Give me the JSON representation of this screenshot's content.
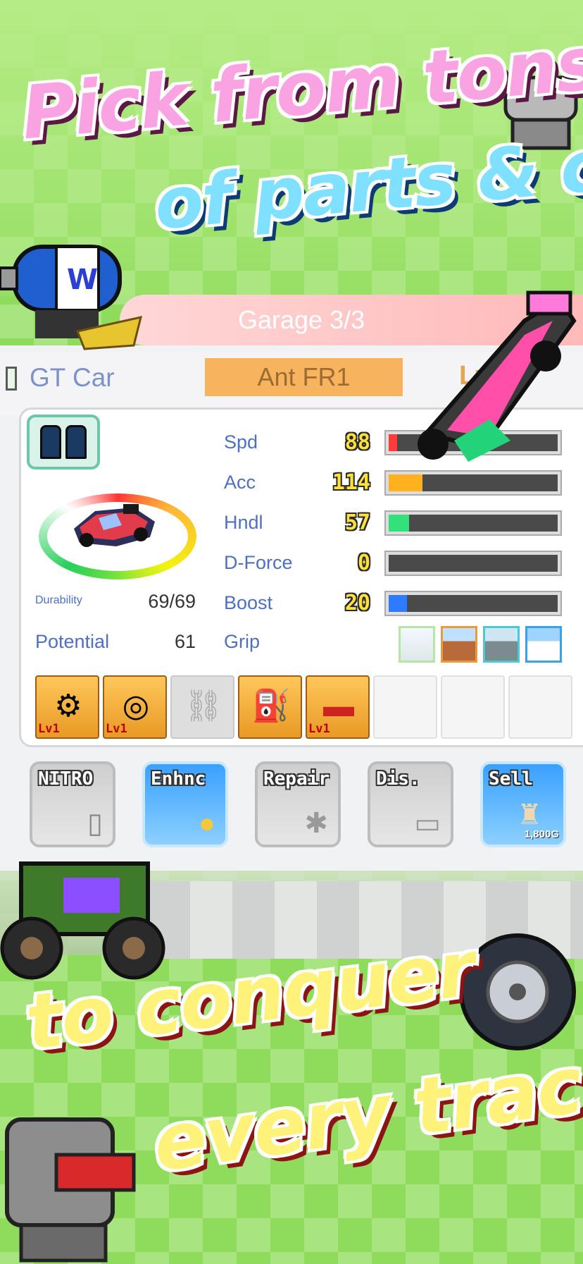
{
  "headline": {
    "line1": "Pick from tons",
    "line2": "of parts & cars",
    "line3": "to conquer",
    "line4": "every track!"
  },
  "garage": {
    "title": "Garage 3/3",
    "car_class": "GT Car",
    "car_name": "Ant FR1",
    "level_mark": "Lv"
  },
  "car": {
    "durability_label": "Durability",
    "durability_value": "69/69",
    "potential_label": "Potential",
    "potential_value": "61"
  },
  "stats": [
    {
      "label": "Spd",
      "value": "88",
      "level": 0.05,
      "color": "#ff3c3c"
    },
    {
      "label": "Acc",
      "value": "114",
      "level": 0.2,
      "color": "#ffb21e"
    },
    {
      "label": "Hndl",
      "value": "57",
      "level": 0.12,
      "color": "#34e07a"
    },
    {
      "label": "D-Force",
      "value": "0",
      "level": 0,
      "color": "#cccccc"
    },
    {
      "label": "Boost",
      "value": "20",
      "level": 0.11,
      "color": "#2f7bff"
    }
  ],
  "grip": {
    "label": "Grip",
    "icons": [
      "road-icon",
      "dirt-icon",
      "gravel-icon",
      "snow-icon"
    ]
  },
  "parts": [
    {
      "icon": "engine-icon",
      "level": "Lv1"
    },
    {
      "icon": "tire-icon",
      "level": "Lv1"
    },
    {
      "icon": "chain-icon",
      "level": ""
    },
    {
      "icon": "oil-can-icon",
      "level": ""
    },
    {
      "icon": "exhaust-icon",
      "level": "Lv1"
    }
  ],
  "actions": [
    {
      "label": "NITRO",
      "icon": "nitro-tank-icon"
    },
    {
      "label": "Enhnc",
      "icon": "egg-icon"
    },
    {
      "label": "Repair",
      "icon": "wrench-icon"
    },
    {
      "label": "Dis.",
      "icon": "laptop-icon"
    },
    {
      "label": "Sell",
      "icon": "money-bag-icon",
      "price": "1,800G"
    }
  ],
  "colors": {
    "background": "#8fdc5c",
    "headline_top": "#f9a3e3",
    "headline_mid": "#7fe1ff",
    "headline_bottom": "#fff27a",
    "car_name_box": "#f7b35d"
  }
}
